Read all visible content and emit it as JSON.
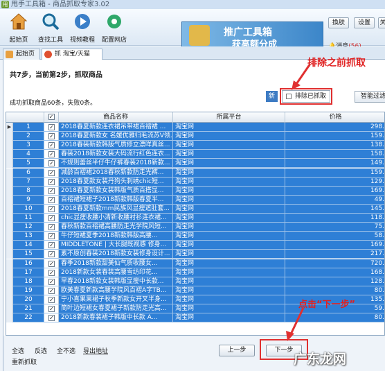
{
  "window": {
    "title": "甩手工具箱 - 商品抓取专家3.02"
  },
  "toolbar": {
    "home_label": "起始页",
    "find_tool_label": "查找工具",
    "video_label": "视频教程",
    "config_label": "配置网店",
    "banner_line1": "推广工具箱",
    "banner_line2": "获高额分成",
    "switch_label": "換肤",
    "settings_label": "设置",
    "extra_label": "关",
    "msg_label": "消息",
    "msg_count": "(56)"
  },
  "tabs": {
    "home": "起始页",
    "taobao": "抓 淘宝/天猫"
  },
  "step_text": "共7步，当前第2步，抓取商品",
  "success_text": "成功抓取商品60条，失败0条。",
  "new_label": "新",
  "exclude_label": "排除已抓取",
  "smart_filter_label": "智能过滤",
  "annotations": {
    "top": "排除之前抓取",
    "bottom": "点击“下一步”"
  },
  "table": {
    "columns": [
      "商品名称",
      "所属平台",
      "价格"
    ],
    "rows": [
      {
        "no": "1",
        "name": "2018春夏新款连衣裙吊带裙百褶裙 ...",
        "platform": "淘宝网",
        "price": "298."
      },
      {
        "no": "2",
        "name": "2018春夏新款女 名媛优雅归毛流苏V领...",
        "platform": "淘宝网",
        "price": "159."
      },
      {
        "no": "3",
        "name": "2018春装新款韩版气质修立漂咩真丝...",
        "platform": "淘宝网",
        "price": "138."
      },
      {
        "no": "4",
        "name": "春装2018新款女装大码流行红色连衣...",
        "platform": "淘宝网",
        "price": "158."
      },
      {
        "no": "5",
        "name": "不规则蕾丝半仔牛仔裤春装2018新款...",
        "platform": "淘宝网",
        "price": "149."
      },
      {
        "no": "6",
        "name": "减龄百褶裙2018春秋新款防走光裤...",
        "platform": "淘宝网",
        "price": "159."
      },
      {
        "no": "7",
        "name": "2018春夏款女装丹狗头刺绣chic短...",
        "platform": "淘宝网",
        "price": "129."
      },
      {
        "no": "8",
        "name": "2018春夏新款女装韩版气质百搭显...",
        "platform": "淘宝网",
        "price": "169."
      },
      {
        "no": "9",
        "name": "百褶裙短裙子2018新款韩版春夏半...",
        "platform": "淘宝网",
        "price": "49."
      },
      {
        "no": "10",
        "name": "2018春夏新款mm民族风显瘦遮肚套...",
        "platform": "淘宝网",
        "price": "145."
      },
      {
        "no": "11",
        "name": "chic显瘦收腰小清新收腰衬衫连衣裙...",
        "platform": "淘宝网",
        "price": "118."
      },
      {
        "no": "12",
        "name": "春秋新款百褶裙高腰防走光学院风短...",
        "platform": "淘宝网",
        "price": "75."
      },
      {
        "no": "13",
        "name": "牛仔短裙夏季2018新款韩版高腰...",
        "platform": "淘宝网",
        "price": "58."
      },
      {
        "no": "14",
        "name": "MIDDLETONE | 大长腿既视感 修身...",
        "platform": "淘宝网",
        "price": "169."
      },
      {
        "no": "15",
        "name": "素不原创春装2018新款女装修身设计...",
        "platform": "淘宝网",
        "price": "217."
      },
      {
        "no": "16",
        "name": "春季2018新款甜美仙气质收腰女...",
        "platform": "淘宝网",
        "price": "720."
      },
      {
        "no": "17",
        "name": "2018新款女装春装高腰雪纺印花...",
        "platform": "淘宝网",
        "price": "168."
      },
      {
        "no": "18",
        "name": "早春2018新款女装韩版显瘦中长款...",
        "platform": "淘宝网",
        "price": "128."
      },
      {
        "no": "19",
        "name": "欧美春夏新款高腰学院风百褶A字TB...",
        "platform": "淘宝网",
        "price": "80."
      },
      {
        "no": "20",
        "name": "宁小喜果果裙子秋季新款女开叉半身...",
        "platform": "淘宝网",
        "price": "135."
      },
      {
        "no": "21",
        "name": "简叶边短裙女春夏裙子新款防走光高...",
        "platform": "淘宝网",
        "price": "59."
      },
      {
        "no": "22",
        "name": "2018新款春装裙子韩版中长款 A...",
        "platform": "淘宝网",
        "price": "80."
      }
    ]
  },
  "bottom": {
    "select_all": "全选",
    "invert": "反选",
    "select_none": "全不选",
    "export": "导出地址",
    "refetch": "重新抓取",
    "prev": "上一步",
    "next": "下一步"
  },
  "watermark": "广东龙网",
  "colors": {
    "row_highlight": "#2e7fd6",
    "annotation": "#e03030"
  }
}
